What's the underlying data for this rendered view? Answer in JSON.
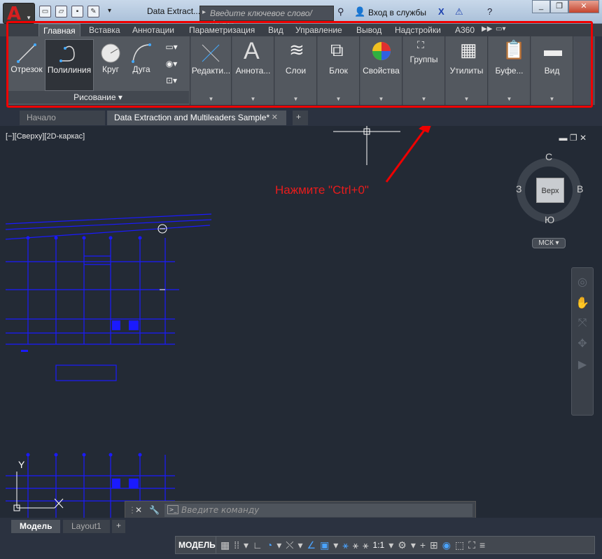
{
  "titlebar": {
    "title": "Data Extract...",
    "search_placeholder": "Введите ключевое слово/фразу",
    "login": "Вход в службы",
    "icons": [
      "binoculars-icon",
      "user-icon",
      "exchange-x-icon",
      "a360-icon",
      "help-icon"
    ]
  },
  "ribbon": {
    "tabs": [
      "Главная",
      "Вставка",
      "Аннотации",
      "Параметризация",
      "Вид",
      "Управление",
      "Вывод",
      "Надстройки",
      "A360"
    ],
    "draw_panel_label": "Рисование",
    "tools": {
      "line": "Отрезок",
      "polyline": "Полилиния",
      "circle": "Круг",
      "arc": "Дуга"
    },
    "panels": [
      "Редакти...",
      "Аннота...",
      "Слои",
      "Блок",
      "Свойства",
      "Группы",
      "Утилиты",
      "Буфе...",
      "Вид"
    ]
  },
  "doc_tabs": {
    "start": "Начало",
    "active": "Data Extraction and Multileaders Sample*",
    "close": "✕",
    "add": "+"
  },
  "viewport": {
    "label": "[−][Сверху][2D-каркас]",
    "controls": "▬  ❐  ✕",
    "callout": "Нажмите \"Ctrl+0\"",
    "viewcube": {
      "face": "Верх",
      "north": "С",
      "south": "Ю",
      "west": "З",
      "east": "В"
    },
    "ucs": "МСК ▾",
    "axis_y": "Y",
    "axis_x": "X"
  },
  "command_line": {
    "placeholder": "Введите команду",
    "close": "✕",
    "settings": "🔧"
  },
  "layout_tabs": {
    "model": "Модель",
    "layout1": "Layout1",
    "add": "+"
  },
  "status": {
    "model": "МОДЕЛЬ",
    "scale": "1:1"
  },
  "colors": {
    "highlight": "#ee0000",
    "drawing_lines": "#1a1aff",
    "callout_text": "#e81c1c"
  }
}
